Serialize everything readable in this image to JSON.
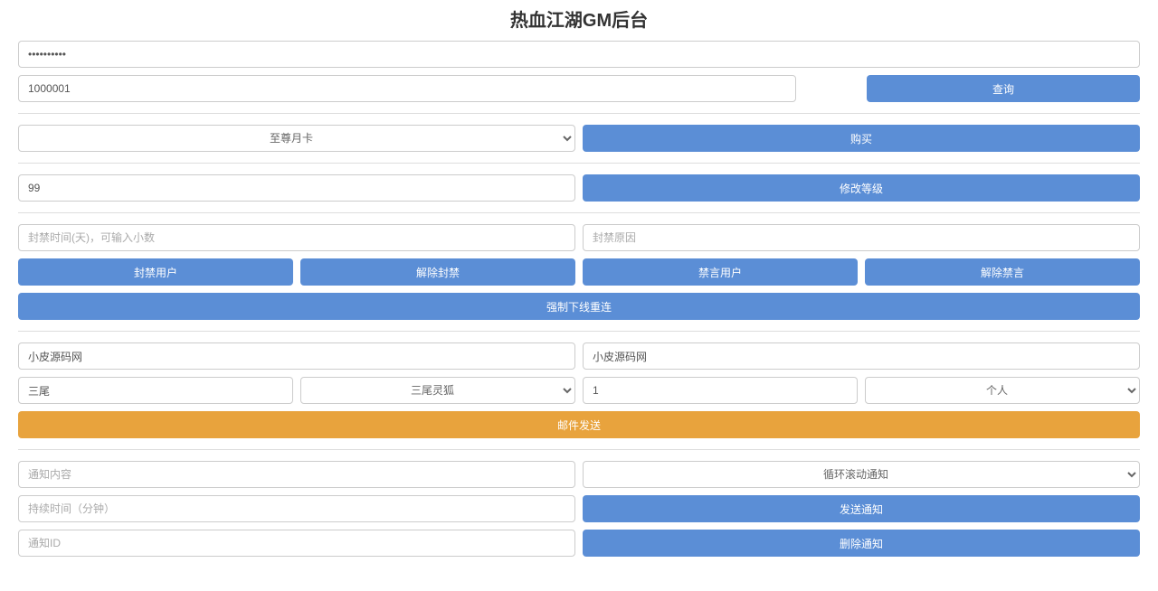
{
  "title": "热血江湖GM后台",
  "auth": {
    "password_value": "••••••••••"
  },
  "query": {
    "user_id": "1000001",
    "btn": "查询"
  },
  "buy": {
    "select": "至尊月卡",
    "btn": "购买"
  },
  "level": {
    "value": "99",
    "btn": "修改等级"
  },
  "ban": {
    "time_ph": "封禁时间(天)，可输入小数",
    "reason_ph": "封禁原因",
    "ban_user": "封禁用户",
    "unban": "解除封禁",
    "mute_user": "禁言用户",
    "unmute": "解除禁言",
    "force_relogin": "强制下线重连"
  },
  "mail": {
    "sender": "小皮源码网",
    "sender_right": "小皮源码网",
    "item_search": "三尾",
    "item_select": "三尾灵狐",
    "quantity": "1",
    "target": "个人",
    "send": "邮件发送"
  },
  "notice": {
    "content_ph": "通知内容",
    "type_select": "循环滚动通知",
    "duration_ph": "持续时间（分钟）",
    "send": "发送通知",
    "id_ph": "通知ID",
    "delete": "删除通知"
  }
}
